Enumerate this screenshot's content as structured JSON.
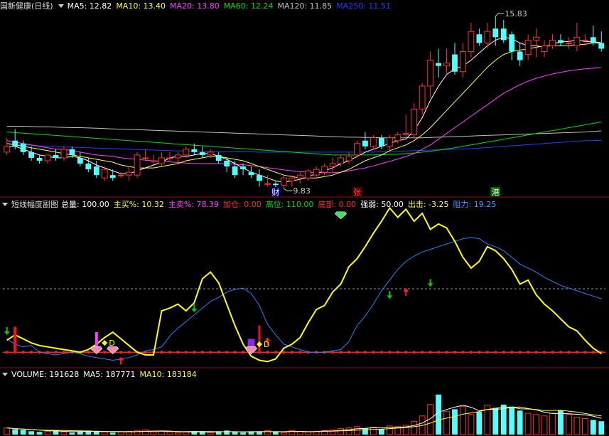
{
  "colors": {
    "bg": "#000000",
    "up": "#ff3030",
    "down": "#54ffff",
    "ma5": "#ffffff",
    "ma10": "#ffff40",
    "ma20": "#ff40ff",
    "ma60": "#00dd00",
    "ma120": "#c0c0c0",
    "ma250": "#2040ff",
    "divider": "#8b1010",
    "grid": "#7a1010",
    "line_strength": "#ffff00",
    "line_resist": "#2f7fff",
    "baseline": "#ff2020"
  },
  "price_panel": {
    "title": "国新健康(日线)",
    "legend": [
      {
        "label": "MA5: 12.82",
        "color": "#ffffff"
      },
      {
        "label": "MA10: 13.40",
        "color": "#ffff40"
      },
      {
        "label": "MA20: 13.80",
        "color": "#ff40ff"
      },
      {
        "label": "MA60: 12.24",
        "color": "#00dd00"
      },
      {
        "label": "MA120: 11.85",
        "color": "#c0c0c0"
      },
      {
        "label": "MA250: 11.51",
        "color": "#2040ff"
      }
    ],
    "high_label": "15.83",
    "low_label": "9.83",
    "markers": [
      {
        "text": "财",
        "color": "#ffffff",
        "bg": "#00006a"
      },
      {
        "text": "张",
        "color": "#ff4040",
        "bg": "#4a0000"
      },
      {
        "text": "港",
        "color": "#ffffff",
        "bg": "#006600"
      }
    ]
  },
  "indicator_panel": {
    "title": "短线幅度副图",
    "legend": [
      {
        "label": "总量: 100.00",
        "color": "#ffffff"
      },
      {
        "label": "主买%: 10.32",
        "color": "#ffff40"
      },
      {
        "label": "主卖%: 78.39",
        "color": "#ff40ff"
      },
      {
        "label": "加仓: 0.00",
        "color": "#ff3030"
      },
      {
        "label": "高位: 110.00",
        "color": "#00dd00"
      },
      {
        "label": "底部: 0.00",
        "color": "#ff3030"
      },
      {
        "label": "强弱: 50.00",
        "color": "#ffffff"
      },
      {
        "label": "出击: -3.25",
        "color": "#ffff40"
      },
      {
        "label": "阻力: 19.25",
        "color": "#3fa0ff"
      }
    ],
    "signal_text": "D"
  },
  "volume_panel": {
    "legend": [
      {
        "label": "VOLUME: 191628",
        "color": "#ffffff"
      },
      {
        "label": "MA5: 187771",
        "color": "#ffffff"
      },
      {
        "label": "MA10: 183184",
        "color": "#ffff40"
      }
    ]
  },
  "chart_data": {
    "type": "candlestick",
    "candles": [
      [
        11.1,
        11.6,
        11.0,
        11.3
      ],
      [
        11.5,
        11.9,
        11.2,
        11.3
      ],
      [
        11.4,
        11.5,
        11.0,
        11.1
      ],
      [
        11.1,
        11.3,
        10.8,
        10.9
      ],
      [
        10.9,
        11.0,
        10.7,
        10.8
      ],
      [
        10.8,
        11.0,
        10.7,
        11.0
      ],
      [
        11.0,
        11.2,
        10.8,
        10.9
      ],
      [
        10.9,
        11.3,
        10.8,
        11.2
      ],
      [
        11.2,
        11.3,
        10.9,
        11.0
      ],
      [
        10.9,
        11.1,
        10.6,
        10.7
      ],
      [
        10.7,
        10.9,
        10.4,
        10.5
      ],
      [
        10.6,
        10.8,
        10.2,
        10.3
      ],
      [
        10.2,
        10.6,
        10.1,
        10.5
      ],
      [
        10.3,
        10.5,
        10.1,
        10.2
      ],
      [
        10.3,
        10.4,
        10.2,
        10.3
      ],
      [
        10.3,
        10.6,
        10.1,
        10.4
      ],
      [
        10.3,
        11.1,
        10.2,
        11.0
      ],
      [
        10.9,
        11.2,
        10.8,
        10.9
      ],
      [
        10.8,
        11.0,
        10.7,
        10.8
      ],
      [
        10.7,
        11.1,
        10.6,
        10.9
      ],
      [
        10.9,
        11.1,
        10.8,
        10.9
      ],
      [
        10.9,
        11.1,
        10.7,
        11.0
      ],
      [
        11.0,
        11.3,
        10.9,
        11.2
      ],
      [
        11.2,
        11.4,
        11.0,
        11.1
      ],
      [
        11.1,
        11.3,
        10.9,
        11.0
      ],
      [
        11.0,
        11.2,
        10.9,
        11.1
      ],
      [
        11.0,
        11.1,
        10.7,
        10.8
      ],
      [
        10.8,
        10.9,
        10.4,
        10.6
      ],
      [
        10.6,
        10.8,
        10.2,
        10.3
      ],
      [
        10.6,
        10.7,
        10.3,
        10.5
      ],
      [
        10.4,
        10.6,
        10.2,
        10.3
      ],
      [
        10.3,
        10.5,
        9.9,
        10.1
      ],
      [
        10.0,
        10.3,
        9.9,
        10.0
      ],
      [
        10.0,
        10.1,
        9.85,
        9.95
      ],
      [
        9.95,
        10.3,
        9.83,
        10.2
      ],
      [
        10.1,
        10.3,
        9.9,
        10.2
      ],
      [
        10.2,
        10.4,
        10.0,
        10.3
      ],
      [
        10.2,
        10.5,
        10.1,
        10.45
      ],
      [
        10.3,
        10.6,
        10.2,
        10.5
      ],
      [
        10.4,
        10.7,
        10.3,
        10.6
      ],
      [
        10.6,
        10.9,
        10.4,
        10.7
      ],
      [
        10.7,
        11.0,
        10.6,
        10.9
      ],
      [
        10.8,
        11.1,
        10.7,
        10.95
      ],
      [
        11.0,
        11.5,
        10.9,
        11.4
      ],
      [
        11.5,
        11.8,
        11.2,
        11.3
      ],
      [
        11.3,
        11.7,
        11.2,
        11.6
      ],
      [
        11.6,
        11.7,
        11.2,
        11.3
      ],
      [
        11.3,
        11.7,
        11.1,
        11.6
      ],
      [
        11.5,
        11.8,
        11.4,
        11.7
      ],
      [
        11.7,
        12.4,
        11.6,
        11.75
      ],
      [
        11.7,
        12.8,
        11.6,
        12.6
      ],
      [
        12.6,
        13.5,
        12.4,
        13.4
      ],
      [
        13.4,
        14.6,
        13.0,
        14.3
      ],
      [
        14.2,
        14.7,
        13.7,
        14.1
      ],
      [
        14.1,
        14.7,
        13.8,
        14.2
      ],
      [
        14.5,
        14.9,
        13.8,
        13.9
      ],
      [
        13.9,
        14.9,
        13.7,
        14.6
      ],
      [
        14.6,
        15.6,
        14.4,
        15.3
      ],
      [
        15.2,
        15.4,
        14.8,
        14.9
      ],
      [
        14.9,
        15.6,
        14.7,
        15.3
      ],
      [
        15.4,
        15.83,
        14.8,
        15.1
      ],
      [
        15.4,
        15.7,
        14.9,
        15.0
      ],
      [
        15.2,
        15.3,
        14.3,
        14.6
      ],
      [
        14.6,
        14.9,
        14.1,
        14.3
      ],
      [
        14.5,
        15.2,
        14.3,
        15.0
      ],
      [
        15.0,
        15.4,
        14.4,
        15.1
      ],
      [
        14.6,
        15.0,
        14.4,
        14.8
      ],
      [
        14.8,
        15.2,
        14.7,
        15.0
      ],
      [
        15.0,
        15.2,
        14.8,
        14.9
      ],
      [
        14.9,
        15.1,
        14.7,
        14.9
      ],
      [
        14.8,
        15.6,
        14.6,
        15.1
      ],
      [
        15.0,
        15.2,
        14.8,
        15.0
      ],
      [
        15.1,
        15.5,
        14.8,
        14.9
      ],
      [
        14.9,
        15.3,
        14.6,
        14.7
      ]
    ],
    "ma5": [
      11.3,
      11.3,
      11.2,
      11.1,
      11.0,
      10.95,
      10.9,
      10.9,
      10.95,
      10.9,
      10.8,
      10.65,
      10.55,
      10.45,
      10.35,
      10.35,
      10.45,
      10.55,
      10.65,
      10.75,
      10.9,
      10.95,
      10.95,
      11.0,
      11.05,
      11.05,
      10.95,
      10.85,
      10.7,
      10.55,
      10.4,
      10.3,
      10.2,
      10.1,
      10.05,
      10.1,
      10.15,
      10.25,
      10.35,
      10.45,
      10.55,
      10.7,
      10.8,
      10.95,
      11.1,
      11.2,
      11.3,
      11.4,
      11.5,
      11.55,
      11.85,
      12.3,
      12.9,
      13.4,
      13.8,
      14.0,
      14.1,
      14.3,
      14.55,
      14.8,
      15.0,
      15.1,
      15.05,
      14.9,
      14.8,
      14.8,
      14.75,
      14.85,
      14.95,
      14.95,
      15.0,
      14.95,
      14.95,
      14.9
    ],
    "ma10": [
      11.4,
      11.35,
      11.3,
      11.25,
      11.2,
      11.15,
      11.1,
      11.05,
      11.0,
      10.95,
      10.9,
      10.85,
      10.8,
      10.75,
      10.65,
      10.6,
      10.55,
      10.55,
      10.55,
      10.6,
      10.65,
      10.7,
      10.8,
      10.85,
      10.9,
      10.95,
      10.95,
      10.9,
      10.85,
      10.8,
      10.7,
      10.6,
      10.5,
      10.4,
      10.3,
      10.25,
      10.2,
      10.2,
      10.2,
      10.25,
      10.3,
      10.4,
      10.5,
      10.65,
      10.8,
      10.9,
      11.0,
      11.15,
      11.25,
      11.35,
      11.5,
      11.7,
      11.95,
      12.25,
      12.55,
      12.85,
      13.15,
      13.45,
      13.75,
      14.05,
      14.3,
      14.5,
      14.6,
      14.65,
      14.7,
      14.75,
      14.8,
      14.8,
      14.8,
      14.8,
      14.85,
      14.85,
      14.9,
      14.9
    ],
    "ma20": [
      11.5,
      11.45,
      11.4,
      11.35,
      11.3,
      11.25,
      11.2,
      11.2,
      11.15,
      11.1,
      11.05,
      11.0,
      10.98,
      10.95,
      10.9,
      10.87,
      10.85,
      10.82,
      10.8,
      10.78,
      10.76,
      10.74,
      10.72,
      10.7,
      10.7,
      10.7,
      10.7,
      10.7,
      10.68,
      10.66,
      10.63,
      10.6,
      10.56,
      10.52,
      10.48,
      10.45,
      10.42,
      10.4,
      10.38,
      10.38,
      10.38,
      10.4,
      10.45,
      10.5,
      10.55,
      10.62,
      10.7,
      10.78,
      10.86,
      10.95,
      11.05,
      11.2,
      11.35,
      11.55,
      11.75,
      11.95,
      12.15,
      12.35,
      12.55,
      12.75,
      12.95,
      13.15,
      13.3,
      13.45,
      13.57,
      13.67,
      13.75,
      13.82,
      13.88,
      13.93,
      13.97,
      14.0,
      14.02,
      14.04
    ],
    "ma60": [
      11.8,
      11.78,
      11.76,
      11.74,
      11.72,
      11.7,
      11.68,
      11.66,
      11.64,
      11.62,
      11.6,
      11.58,
      11.56,
      11.54,
      11.52,
      11.5,
      11.48,
      11.46,
      11.44,
      11.42,
      11.4,
      11.38,
      11.36,
      11.34,
      11.32,
      11.3,
      11.28,
      11.26,
      11.24,
      11.22,
      11.2,
      11.18,
      11.16,
      11.14,
      11.12,
      11.1,
      11.08,
      11.06,
      11.04,
      11.02,
      11.0,
      11.0,
      11.0,
      11.0,
      11.0,
      11.0,
      11.01,
      11.02,
      11.03,
      11.05,
      11.07,
      11.1,
      11.13,
      11.17,
      11.21,
      11.25,
      11.3,
      11.35,
      11.4,
      11.45,
      11.5,
      11.55,
      11.6,
      11.65,
      11.7,
      11.75,
      11.8,
      11.85,
      11.9,
      11.95,
      12.0,
      12.05,
      12.1,
      12.15
    ],
    "ma120": [
      12.0,
      12.0,
      12.0,
      11.99,
      11.98,
      11.98,
      11.97,
      11.96,
      11.95,
      11.95,
      11.94,
      11.93,
      11.92,
      11.91,
      11.9,
      11.89,
      11.88,
      11.87,
      11.86,
      11.85,
      11.84,
      11.83,
      11.82,
      11.81,
      11.8,
      11.79,
      11.78,
      11.77,
      11.76,
      11.75,
      11.74,
      11.73,
      11.72,
      11.71,
      11.7,
      11.69,
      11.68,
      11.67,
      11.66,
      11.65,
      11.64,
      11.63,
      11.62,
      11.62,
      11.61,
      11.61,
      11.6,
      11.6,
      11.6,
      11.6,
      11.6,
      11.6,
      11.61,
      11.62,
      11.63,
      11.64,
      11.65,
      11.66,
      11.67,
      11.68,
      11.69,
      11.7,
      11.71,
      11.72,
      11.73,
      11.74,
      11.75,
      11.76,
      11.77,
      11.78,
      11.79,
      11.8,
      11.82,
      11.84
    ],
    "ma250": [
      11.4,
      11.38,
      11.36,
      11.34,
      11.32,
      11.3,
      11.29,
      11.28,
      11.27,
      11.26,
      11.25,
      11.24,
      11.23,
      11.22,
      11.21,
      11.2,
      11.19,
      11.18,
      11.17,
      11.16,
      11.15,
      11.14,
      11.14,
      11.13,
      11.13,
      11.12,
      11.12,
      11.12,
      11.11,
      11.11,
      11.11,
      11.1,
      11.1,
      11.1,
      11.1,
      11.1,
      11.1,
      11.1,
      11.1,
      11.1,
      11.1,
      11.1,
      11.1,
      11.1,
      11.1,
      11.1,
      11.11,
      11.12,
      11.13,
      11.14,
      11.15,
      11.16,
      11.17,
      11.18,
      11.19,
      11.2,
      11.21,
      11.22,
      11.24,
      11.26,
      11.28,
      11.3,
      11.32,
      11.34,
      11.36,
      11.38,
      11.4,
      11.42,
      11.44,
      11.46,
      11.48,
      11.5,
      11.5,
      11.51
    ],
    "strength": [
      18,
      26,
      20,
      14,
      10,
      8,
      6,
      4,
      2,
      0,
      4,
      12,
      22,
      30,
      20,
      10,
      0,
      -4,
      -4,
      62,
      66,
      72,
      62,
      74,
      110,
      120,
      104,
      72,
      40,
      12,
      -6,
      -12,
      -14,
      -10,
      6,
      12,
      22,
      44,
      64,
      70,
      90,
      102,
      128,
      140,
      158,
      178,
      196,
      216,
      202,
      214,
      196,
      208,
      184,
      192,
      186,
      166,
      142,
      126,
      136,
      158,
      152,
      140,
      124,
      102,
      108,
      86,
      72,
      62,
      50,
      38,
      32,
      18,
      6,
      -2
    ],
    "resist": [
      20,
      12,
      8,
      10,
      0,
      -2,
      -4,
      -2,
      0,
      -2,
      -6,
      -8,
      -10,
      -12,
      -10,
      -8,
      -4,
      2,
      4,
      8,
      24,
      36,
      46,
      56,
      66,
      76,
      82,
      90,
      94,
      96,
      88,
      70,
      42,
      26,
      12,
      8,
      4,
      0,
      0,
      0,
      2,
      4,
      16,
      40,
      54,
      72,
      92,
      108,
      124,
      136,
      144,
      150,
      154,
      158,
      162,
      166,
      170,
      172,
      170,
      162,
      158,
      152,
      142,
      132,
      126,
      120,
      112,
      106,
      100,
      96,
      92,
      88,
      84,
      80
    ],
    "strength_ylim": [
      -20,
      210
    ],
    "volume": [
      10,
      8,
      7,
      5,
      4,
      5,
      6,
      4,
      3,
      5,
      6,
      5,
      4,
      3,
      4,
      5,
      6,
      7,
      4,
      5,
      4,
      3,
      4,
      5,
      4,
      3,
      5,
      6,
      4,
      3,
      4,
      5,
      6,
      4,
      3,
      6,
      5,
      4,
      5,
      6,
      7,
      9,
      10,
      12,
      9,
      11,
      8,
      13,
      12,
      14,
      20,
      28,
      45,
      60,
      35,
      38,
      42,
      30,
      34,
      44,
      40,
      45,
      42,
      36,
      32,
      30,
      28,
      32,
      36,
      30,
      26,
      24,
      22,
      20
    ],
    "volume_ylim": [
      0,
      80
    ]
  }
}
